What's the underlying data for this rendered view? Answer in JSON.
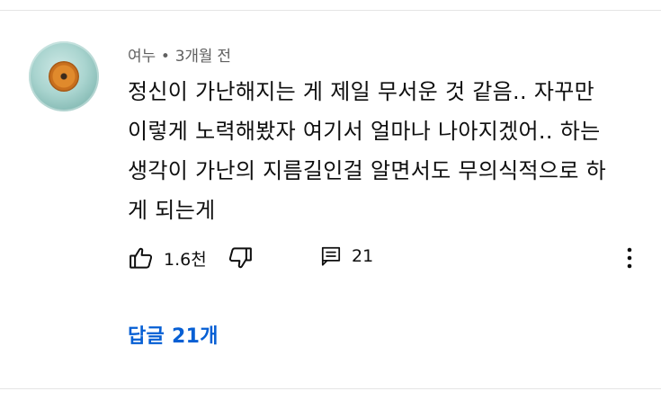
{
  "comment": {
    "author": "여누",
    "separator": "•",
    "timestamp": "3개월 전",
    "lines": [
      "정신이 가난해지는 게 제일 무서운 것 같음.. 자꾸만",
      "이렇게 노력해봤자 여기서 얼마나 나아지겠어.. 하는",
      "생각이 가난의 지름길인걸 알면서도 무의식적으로 하",
      "게 되는게"
    ],
    "likes": "1.6천",
    "reply_count": "21",
    "view_replies": "답글 21개"
  },
  "colors": {
    "text": "#0f0f0f",
    "meta": "#606060",
    "link": "#065fd4",
    "divider": "#e5e5e5"
  },
  "icons": [
    "like-icon",
    "dislike-icon",
    "reply-icon",
    "more-vert-icon"
  ]
}
